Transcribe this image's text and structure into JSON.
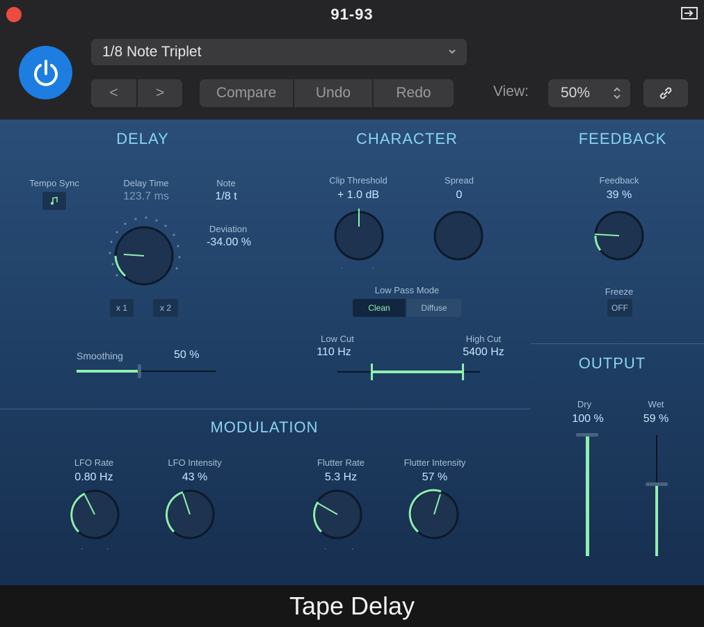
{
  "window": {
    "title": "91-93"
  },
  "header": {
    "preset": "1/8 Note Triplet",
    "prev_label": "<",
    "next_label": ">",
    "compare_label": "Compare",
    "undo_label": "Undo",
    "redo_label": "Redo",
    "view_label": "View:",
    "zoom_value": "50%"
  },
  "delay": {
    "title": "DELAY",
    "tempo_sync_label": "Tempo Sync",
    "delay_time_label": "Delay Time",
    "delay_time_value": "123.7 ms",
    "note_label": "Note",
    "note_value": "1/8 t",
    "deviation_label": "Deviation",
    "deviation_value": "-34.00 %",
    "half_label": "x 1",
    "double_label": "x 2",
    "smoothing_label": "Smoothing",
    "smoothing_value": "50 %",
    "smoothing_fraction": 0.5
  },
  "character": {
    "title": "CHARACTER",
    "clip_label": "Clip Threshold",
    "clip_value": "+ 1.0 dB",
    "spread_label": "Spread",
    "spread_value": "0",
    "mode_label": "Low Pass Mode",
    "mode_options": [
      "Clean",
      "Diffuse"
    ],
    "low_cut_label": "Low Cut",
    "low_cut_value": "110 Hz",
    "high_cut_label": "High Cut",
    "high_cut_value": "5400 Hz"
  },
  "feedback": {
    "title": "FEEDBACK",
    "feedback_label": "Feedback",
    "feedback_value": "39 %",
    "freeze_label": "Freeze",
    "freeze_value": "OFF"
  },
  "output": {
    "title": "OUTPUT",
    "dry_label": "Dry",
    "dry_value": "100 %",
    "wet_label": "Wet",
    "wet_value": "59 %"
  },
  "modulation": {
    "title": "MODULATION",
    "lfo_rate_label": "LFO Rate",
    "lfo_rate_value": "0.80 Hz",
    "lfo_intensity_label": "LFO Intensity",
    "lfo_intensity_value": "43 %",
    "flutter_rate_label": "Flutter Rate",
    "flutter_rate_value": "5.3 Hz",
    "flutter_intensity_label": "Flutter Intensity",
    "flutter_intensity_value": "57 %"
  },
  "footer": {
    "title": "Tape Delay"
  },
  "colors": {
    "accent_green": "#8ff0ae",
    "power_blue": "#1e7de0",
    "section_title": "#8ad4f2"
  }
}
